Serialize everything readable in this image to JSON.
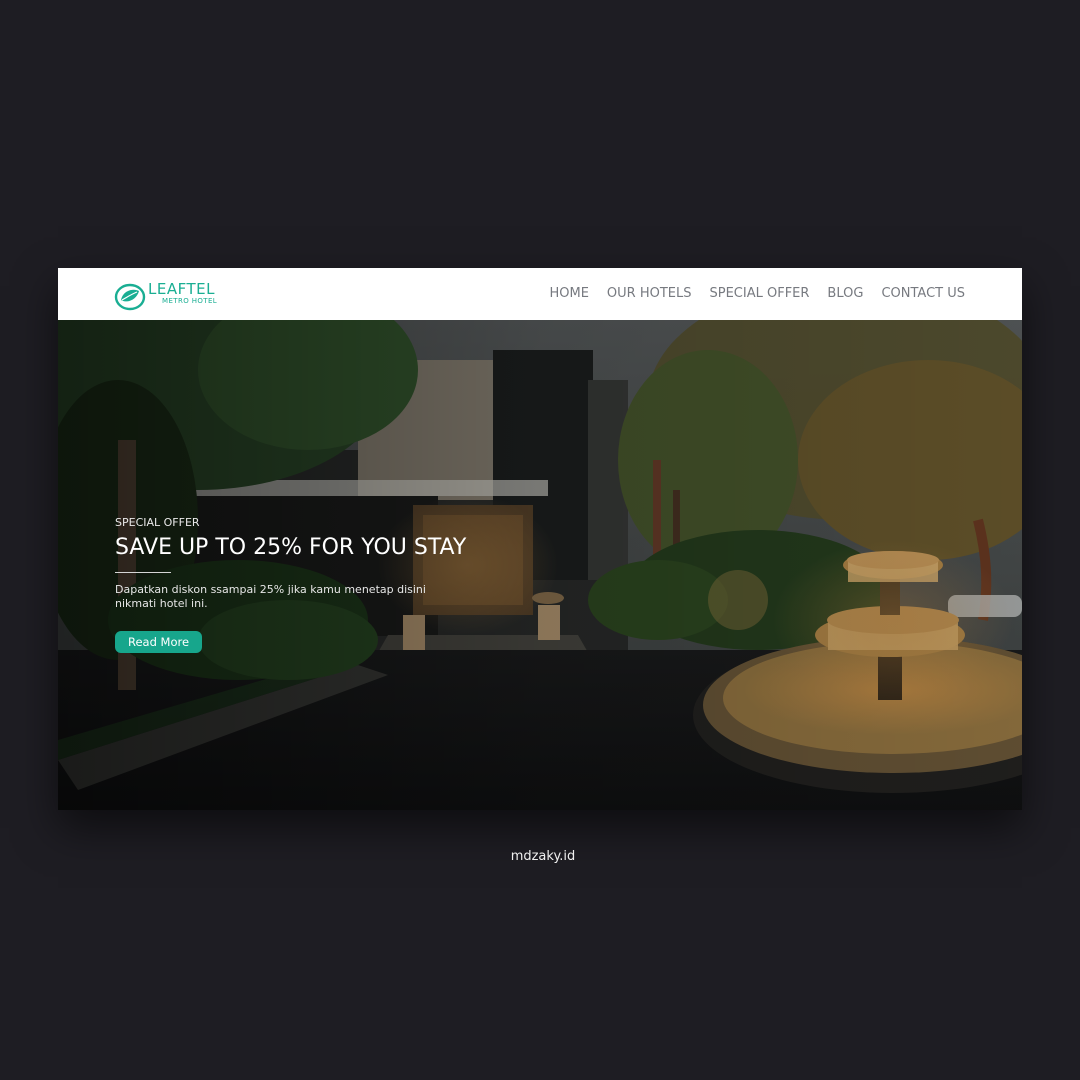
{
  "brand": {
    "name": "LEAFTEL",
    "tagline": "METRO HOTEL",
    "logo_icon": "leaf-icon",
    "accent_color": "#1aae93"
  },
  "nav": {
    "items": [
      {
        "label": "HOME"
      },
      {
        "label": "OUR HOTELS"
      },
      {
        "label": "SPECIAL OFFER"
      },
      {
        "label": "BLOG"
      },
      {
        "label": "CONTACT US"
      }
    ]
  },
  "hero": {
    "eyebrow": "SPECIAL OFFER",
    "headline": "SAVE UP TO 25% FOR YOU STAY",
    "description": "Dapatkan diskon ssampai 25% jika kamu menetap disini nikmati hotel ini.",
    "cta_label": "Read More",
    "cta_color": "#17a68c"
  },
  "credit": "mdzaky.id",
  "page_background": "#1e1d23"
}
